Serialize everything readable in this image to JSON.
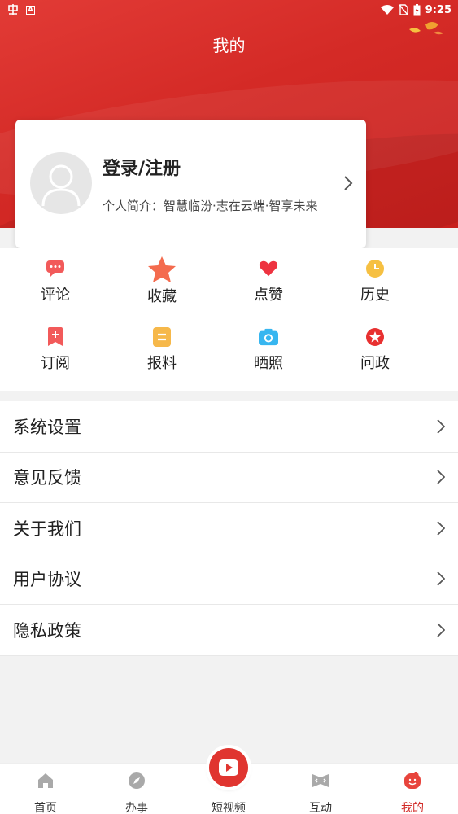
{
  "status_bar": {
    "time": "9:25",
    "left_badge": "A"
  },
  "header": {
    "title": "我的"
  },
  "profile": {
    "login_label": "登录/注册",
    "bio": "个人简介：智慧临汾·志在云端·智享未来"
  },
  "quick_actions": [
    {
      "label": "评论",
      "icon": "comment-icon",
      "color": "#f25a5a"
    },
    {
      "label": "收藏",
      "icon": "star-icon",
      "color": "#f46b4e"
    },
    {
      "label": "点赞",
      "icon": "heart-icon",
      "color": "#ee3340"
    },
    {
      "label": "历史",
      "icon": "clock-icon",
      "color": "#f6c042"
    },
    {
      "label": "订阅",
      "icon": "bookmark-icon",
      "color": "#f25a5a"
    },
    {
      "label": "报料",
      "icon": "document-icon",
      "color": "#f6b84a"
    },
    {
      "label": "晒照",
      "icon": "camera-icon",
      "color": "#37b6f0"
    },
    {
      "label": "问政",
      "icon": "star-badge-icon",
      "color": "#e83030"
    }
  ],
  "settings": [
    {
      "label": "系统设置"
    },
    {
      "label": "意见反馈"
    },
    {
      "label": "关于我们"
    },
    {
      "label": "用户协议"
    },
    {
      "label": "隐私政策"
    }
  ],
  "tabs": [
    {
      "label": "首页",
      "icon": "home-icon"
    },
    {
      "label": "办事",
      "icon": "compass-icon"
    },
    {
      "label": "短视频",
      "icon": "video-play-icon"
    },
    {
      "label": "互动",
      "icon": "interact-icon"
    },
    {
      "label": "我的",
      "icon": "profile-face-icon",
      "active": true
    }
  ],
  "colors": {
    "brand_red": "#d42a26",
    "active_tab": "#d22a27"
  }
}
